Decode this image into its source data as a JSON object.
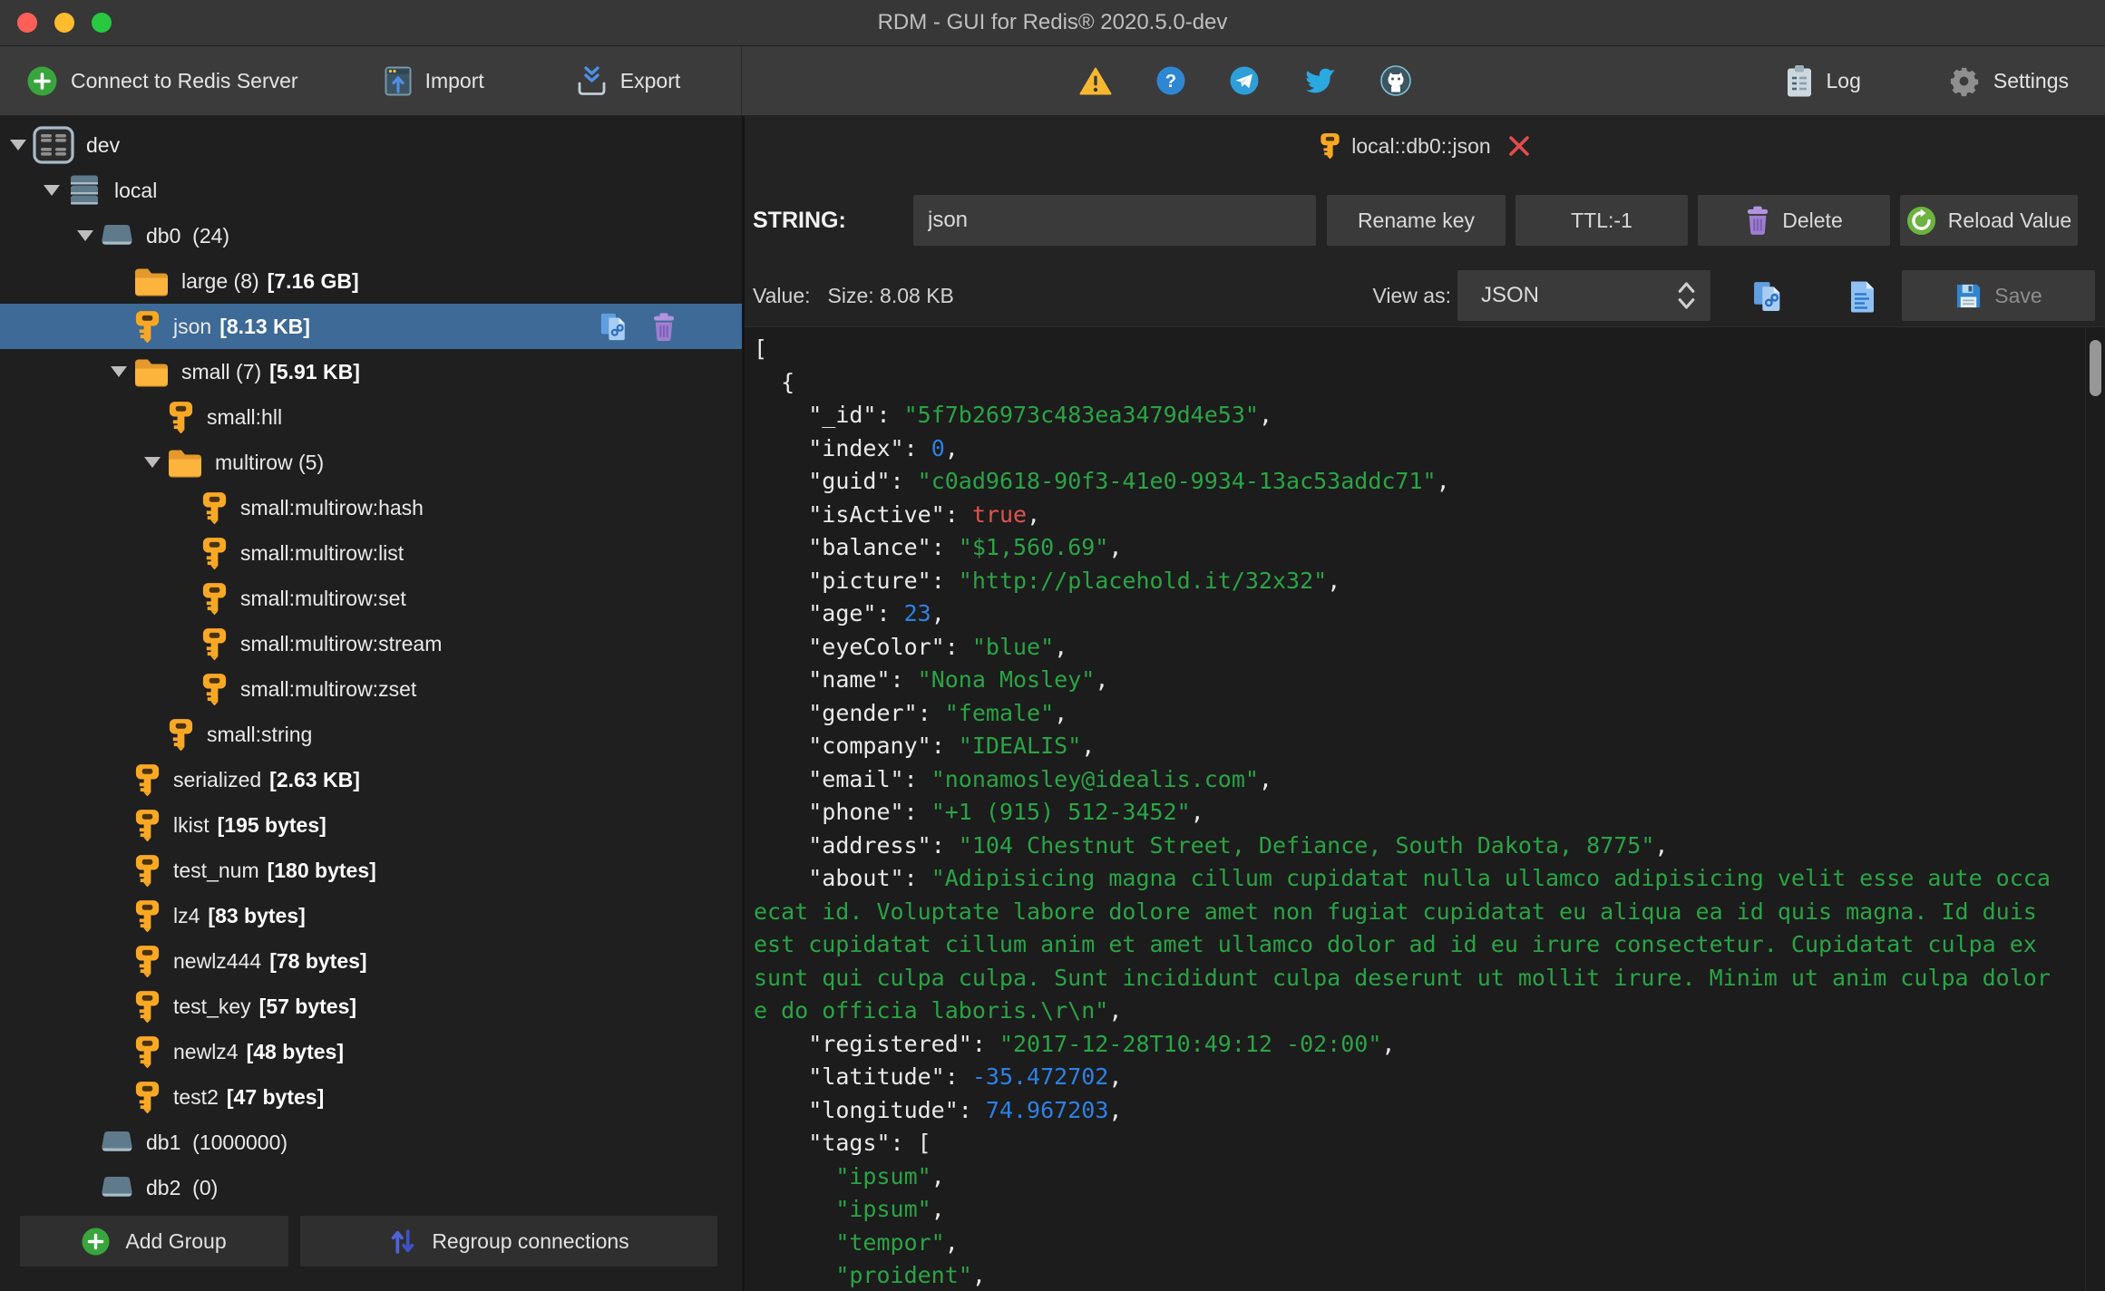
{
  "window": {
    "title": "RDM - GUI for Redis® 2020.5.0-dev"
  },
  "toolbar": {
    "connect_label": "Connect to Redis Server",
    "import_label": "Import",
    "export_label": "Export",
    "log_label": "Log",
    "settings_label": "Settings"
  },
  "sidebar": {
    "add_group_label": "Add Group",
    "regroup_label": "Regroup connections",
    "tree": [
      {
        "level": 0,
        "arrow": true,
        "icon": "connection",
        "label": "dev"
      },
      {
        "level": 1,
        "arrow": true,
        "icon": "server",
        "label": "local"
      },
      {
        "level": 2,
        "arrow": true,
        "icon": "database",
        "label": "db0  (24)"
      },
      {
        "level": 3,
        "arrow": false,
        "icon": "folder",
        "label": "large (8)",
        "size": "[7.16 GB]"
      },
      {
        "level": 3,
        "arrow": false,
        "icon": "key",
        "label": "json",
        "size": "[8.13 KB]",
        "selected": true,
        "actions": true
      },
      {
        "level": 3,
        "arrow": true,
        "icon": "folder",
        "label": "small (7)",
        "size": "[5.91 KB]"
      },
      {
        "level": 4,
        "arrow": false,
        "icon": "key",
        "label": "small:hll"
      },
      {
        "level": 4,
        "arrow": true,
        "icon": "folder",
        "label": "multirow (5)"
      },
      {
        "level": 5,
        "arrow": false,
        "icon": "key",
        "label": "small:multirow:hash"
      },
      {
        "level": 5,
        "arrow": false,
        "icon": "key",
        "label": "small:multirow:list"
      },
      {
        "level": 5,
        "arrow": false,
        "icon": "key",
        "label": "small:multirow:set"
      },
      {
        "level": 5,
        "arrow": false,
        "icon": "key",
        "label": "small:multirow:stream"
      },
      {
        "level": 5,
        "arrow": false,
        "icon": "key",
        "label": "small:multirow:zset"
      },
      {
        "level": 4,
        "arrow": false,
        "icon": "key",
        "label": "small:string"
      },
      {
        "level": 3,
        "arrow": false,
        "icon": "key",
        "label": "serialized",
        "size": "[2.63 KB]"
      },
      {
        "level": 3,
        "arrow": false,
        "icon": "key",
        "label": "lkist",
        "size": "[195 bytes]"
      },
      {
        "level": 3,
        "arrow": false,
        "icon": "key",
        "label": "test_num",
        "size": "[180 bytes]"
      },
      {
        "level": 3,
        "arrow": false,
        "icon": "key",
        "label": "lz4",
        "size": "[83 bytes]"
      },
      {
        "level": 3,
        "arrow": false,
        "icon": "key",
        "label": "newlz444",
        "size": "[78 bytes]"
      },
      {
        "level": 3,
        "arrow": false,
        "icon": "key",
        "label": "test_key",
        "size": "[57 bytes]"
      },
      {
        "level": 3,
        "arrow": false,
        "icon": "key",
        "label": "newlz4",
        "size": "[48 bytes]"
      },
      {
        "level": 3,
        "arrow": false,
        "icon": "key",
        "label": "test2",
        "size": "[47 bytes]"
      },
      {
        "level": 2,
        "arrow": false,
        "icon": "database",
        "label": "db1  (1000000)"
      },
      {
        "level": 2,
        "arrow": false,
        "icon": "database",
        "label": "db2  (0)"
      }
    ]
  },
  "tab": {
    "title": "local::db0::json"
  },
  "key_editor": {
    "type_label": "STRING:",
    "key_name": "json",
    "rename_label": "Rename key",
    "ttl_label": "TTL:-1",
    "delete_label": "Delete",
    "reload_label": "Reload Value",
    "value_label": "Value:",
    "size_label": "Size: 8.08 KB",
    "view_as_label": "View as:",
    "view_as_value": "JSON",
    "save_label": "Save"
  },
  "colors": {
    "selection": "#3d6a96",
    "string_token": "#2aa445",
    "number_token": "#2d81e5",
    "boolean_token": "#e0534f",
    "key_token": "#eaeaea",
    "key_icon_orange": "#f9a825",
    "close_red": "#e24c4c"
  },
  "editor": {
    "lines": [
      [
        [
          "p",
          "["
        ]
      ],
      [
        [
          "p",
          "  {"
        ]
      ],
      [
        [
          "p",
          "    "
        ],
        [
          "k",
          "\"_id\""
        ],
        [
          "p",
          ": "
        ],
        [
          "s",
          "\"5f7b26973c483ea3479d4e53\""
        ],
        [
          "p",
          ","
        ]
      ],
      [
        [
          "p",
          "    "
        ],
        [
          "k",
          "\"index\""
        ],
        [
          "p",
          ": "
        ],
        [
          "n",
          "0"
        ],
        [
          "p",
          ","
        ]
      ],
      [
        [
          "p",
          "    "
        ],
        [
          "k",
          "\"guid\""
        ],
        [
          "p",
          ": "
        ],
        [
          "s",
          "\"c0ad9618-90f3-41e0-9934-13ac53addc71\""
        ],
        [
          "p",
          ","
        ]
      ],
      [
        [
          "p",
          "    "
        ],
        [
          "k",
          "\"isActive\""
        ],
        [
          "p",
          ": "
        ],
        [
          "b",
          "true"
        ],
        [
          "p",
          ","
        ]
      ],
      [
        [
          "p",
          "    "
        ],
        [
          "k",
          "\"balance\""
        ],
        [
          "p",
          ": "
        ],
        [
          "s",
          "\"$1,560.69\""
        ],
        [
          "p",
          ","
        ]
      ],
      [
        [
          "p",
          "    "
        ],
        [
          "k",
          "\"picture\""
        ],
        [
          "p",
          ": "
        ],
        [
          "s",
          "\"http://placehold.it/32x32\""
        ],
        [
          "p",
          ","
        ]
      ],
      [
        [
          "p",
          "    "
        ],
        [
          "k",
          "\"age\""
        ],
        [
          "p",
          ": "
        ],
        [
          "n",
          "23"
        ],
        [
          "p",
          ","
        ]
      ],
      [
        [
          "p",
          "    "
        ],
        [
          "k",
          "\"eyeColor\""
        ],
        [
          "p",
          ": "
        ],
        [
          "s",
          "\"blue\""
        ],
        [
          "p",
          ","
        ]
      ],
      [
        [
          "p",
          "    "
        ],
        [
          "k",
          "\"name\""
        ],
        [
          "p",
          ": "
        ],
        [
          "s",
          "\"Nona Mosley\""
        ],
        [
          "p",
          ","
        ]
      ],
      [
        [
          "p",
          "    "
        ],
        [
          "k",
          "\"gender\""
        ],
        [
          "p",
          ": "
        ],
        [
          "s",
          "\"female\""
        ],
        [
          "p",
          ","
        ]
      ],
      [
        [
          "p",
          "    "
        ],
        [
          "k",
          "\"company\""
        ],
        [
          "p",
          ": "
        ],
        [
          "s",
          "\"IDEALIS\""
        ],
        [
          "p",
          ","
        ]
      ],
      [
        [
          "p",
          "    "
        ],
        [
          "k",
          "\"email\""
        ],
        [
          "p",
          ": "
        ],
        [
          "s",
          "\"nonamosley@idealis.com\""
        ],
        [
          "p",
          ","
        ]
      ],
      [
        [
          "p",
          "    "
        ],
        [
          "k",
          "\"phone\""
        ],
        [
          "p",
          ": "
        ],
        [
          "s",
          "\"+1 (915) 512-3452\""
        ],
        [
          "p",
          ","
        ]
      ],
      [
        [
          "p",
          "    "
        ],
        [
          "k",
          "\"address\""
        ],
        [
          "p",
          ": "
        ],
        [
          "s",
          "\"104 Chestnut Street, Defiance, South Dakota, 8775\""
        ],
        [
          "p",
          ","
        ]
      ],
      [
        [
          "p",
          "    "
        ],
        [
          "k",
          "\"about\""
        ],
        [
          "p",
          ": "
        ],
        [
          "s",
          "\"Adipisicing magna cillum cupidatat nulla ullamco adipisicing velit esse aute occa"
        ]
      ],
      [
        [
          "s",
          "ecat id. Voluptate labore dolore amet non fugiat cupidatat eu aliqua ea id quis magna. Id duis"
        ]
      ],
      [
        [
          "s",
          "est cupidatat cillum anim et amet ullamco dolor ad id eu irure consectetur. Cupidatat culpa ex"
        ]
      ],
      [
        [
          "s",
          "sunt qui culpa culpa. Sunt incididunt culpa deserunt ut mollit irure. Minim ut anim culpa dolor"
        ]
      ],
      [
        [
          "s",
          "e do officia laboris.\\r\\n\""
        ],
        [
          "p",
          ","
        ]
      ],
      [
        [
          "p",
          "    "
        ],
        [
          "k",
          "\"registered\""
        ],
        [
          "p",
          ": "
        ],
        [
          "s",
          "\"2017-12-28T10:49:12 -02:00\""
        ],
        [
          "p",
          ","
        ]
      ],
      [
        [
          "p",
          "    "
        ],
        [
          "k",
          "\"latitude\""
        ],
        [
          "p",
          ": "
        ],
        [
          "n",
          "-35.472702"
        ],
        [
          "p",
          ","
        ]
      ],
      [
        [
          "p",
          "    "
        ],
        [
          "k",
          "\"longitude\""
        ],
        [
          "p",
          ": "
        ],
        [
          "n",
          "74.967203"
        ],
        [
          "p",
          ","
        ]
      ],
      [
        [
          "p",
          "    "
        ],
        [
          "k",
          "\"tags\""
        ],
        [
          "p",
          ": ["
        ]
      ],
      [
        [
          "p",
          "      "
        ],
        [
          "s",
          "\"ipsum\""
        ],
        [
          "p",
          ","
        ]
      ],
      [
        [
          "p",
          "      "
        ],
        [
          "s",
          "\"ipsum\""
        ],
        [
          "p",
          ","
        ]
      ],
      [
        [
          "p",
          "      "
        ],
        [
          "s",
          "\"tempor\""
        ],
        [
          "p",
          ","
        ]
      ],
      [
        [
          "p",
          "      "
        ],
        [
          "s",
          "\"proident\""
        ],
        [
          "p",
          ","
        ]
      ]
    ]
  }
}
